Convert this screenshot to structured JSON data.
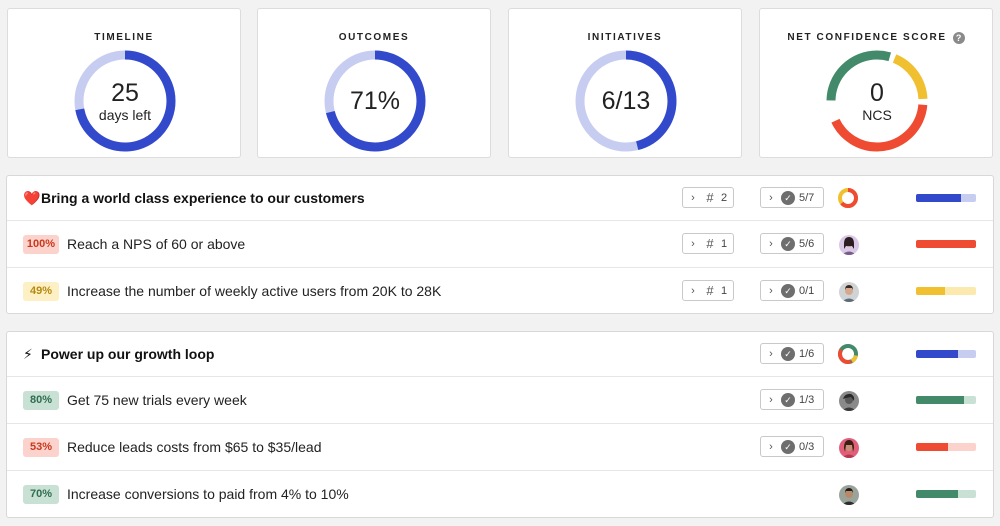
{
  "cards": [
    {
      "title": "TIMELINE",
      "value": "25",
      "sub": "days left",
      "progress": 0.72,
      "color": "#3349cc",
      "track": "#c7cdf0"
    },
    {
      "title": "OUTCOMES",
      "value": "71%",
      "sub": "",
      "progress": 0.71,
      "color": "#3349cc",
      "track": "#c7cdf0"
    },
    {
      "title": "INITIATIVES",
      "value": "6/13",
      "sub": "",
      "progress": 0.46,
      "color": "#3349cc",
      "track": "#c7cdf0"
    },
    {
      "title": "NET CONFIDENCE SCORE",
      "value": "0",
      "sub": "NCS",
      "help": "?"
    }
  ],
  "colors": {
    "blue": "#3349cc",
    "blue_light": "#c7cdf0",
    "red": "#ef4b33",
    "red_light": "#fbd2cc",
    "yellow": "#f0c030",
    "yellow_light": "#fbe9ad",
    "green": "#438a6a",
    "green_light": "#c9e0d5"
  },
  "objectives": [
    {
      "emoji": "❤️",
      "title": "Bring a world class experience to our customers",
      "hash_count": "2",
      "check_label": "5/7",
      "bar": {
        "fill": 0.75,
        "color": "#3349cc",
        "track": "#c7cdf0"
      },
      "key_results": [
        {
          "badge": "100%",
          "badge_bg": "#fbd2cc",
          "badge_color": "#c9391e",
          "text": "Reach a NPS of 60 or above",
          "hash_count": "1",
          "check_label": "5/6",
          "avatar": "avatar-woman-icon",
          "bar": {
            "fill": 1.0,
            "color": "#ef4b33",
            "track": "#fbd2cc"
          }
        },
        {
          "badge": "49%",
          "badge_bg": "#fdf0c4",
          "badge_color": "#b58a10",
          "text": "Increase the number of weekly active users from 20K to 28K",
          "hash_count": "1",
          "check_label": "0/1",
          "avatar": "avatar-man-icon",
          "bar": {
            "fill": 0.49,
            "color": "#f0c030",
            "track": "#fbe9ad"
          }
        }
      ]
    },
    {
      "emoji": "⚡",
      "title": "Power up our growth loop",
      "check_label": "1/6",
      "bar": {
        "fill": 0.7,
        "color": "#3349cc",
        "track": "#c7cdf0"
      },
      "key_results": [
        {
          "badge": "80%",
          "badge_bg": "#c9e0d5",
          "badge_color": "#2f6e50",
          "text": "Get 75 new trials every week",
          "check_label": "1/3",
          "avatar": "avatar-person-icon",
          "bar": {
            "fill": 0.8,
            "color": "#438a6a",
            "track": "#c9e0d5"
          }
        },
        {
          "badge": "53%",
          "badge_bg": "#fbd2cc",
          "badge_color": "#c9391e",
          "text": "Reduce leads costs from $65 to $35/lead",
          "check_label": "0/3",
          "avatar": "avatar-woman-icon",
          "bar": {
            "fill": 0.53,
            "color": "#ef4b33",
            "track": "#fbd2cc"
          }
        },
        {
          "badge": "70%",
          "badge_bg": "#c9e0d5",
          "badge_color": "#2f6e50",
          "text": "Increase conversions to paid from 4% to 10%",
          "avatar": "avatar-man-icon",
          "bar": {
            "fill": 0.7,
            "color": "#438a6a",
            "track": "#c9e0d5"
          }
        }
      ]
    }
  ]
}
